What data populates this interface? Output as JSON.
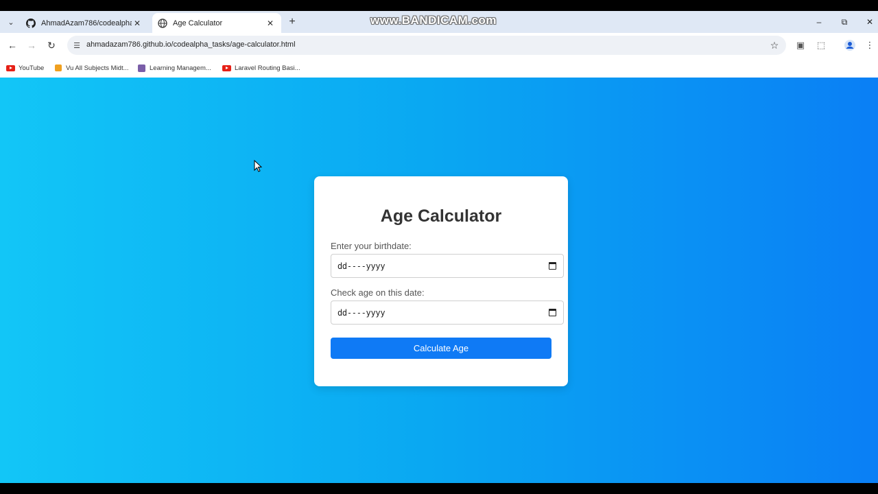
{
  "tabs": [
    {
      "title": "AhmadAzam786/codealpha_ta"
    },
    {
      "title": "Age Calculator"
    }
  ],
  "watermark": "www.BANDICAM.com",
  "address_bar": {
    "url": "ahmadazam786.github.io/codealpha_tasks/age-calculator.html"
  },
  "bookmarks": [
    {
      "label": "YouTube"
    },
    {
      "label": "Vu All Subjects Midt..."
    },
    {
      "label": "Learning Managem..."
    },
    {
      "label": "Laravel Routing Basi..."
    }
  ],
  "app": {
    "title": "Age Calculator",
    "birthdate_label": "Enter your birthdate:",
    "birthdate_value": "dd----yyyy",
    "checkdate_label": "Check age on this date:",
    "checkdate_value": "dd----yyyy",
    "button_label": "Calculate Age"
  },
  "colors": {
    "gradient_start": "#12c6f7",
    "gradient_end": "#0a7ff5",
    "button": "#0f7af5"
  }
}
